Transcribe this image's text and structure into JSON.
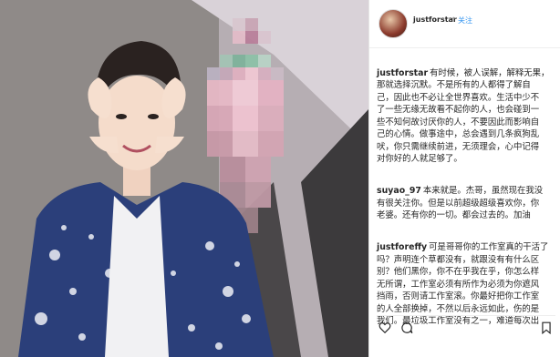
{
  "post": {
    "username": "justforstar",
    "separator": "•",
    "follow_label": "关注",
    "comments": [
      {
        "user": "justforstar",
        "text": "有时候，被人误解，解释无果，\n那就选择沉默。不是所有的人都得了解自\n己，因此也不必让全世界喜欢。生活中少不\n了一些无缘无故看不起你的人，也会碰到一\n些不知何故讨厌你的人，不要因此而影响自\n己的心情。做事途中，总会遇到几条疯狗乱\n吠，你只需继续前进，无须理会，心中记得\n对你好的人就足够了。"
      },
      {
        "user": "suyao_97",
        "text": "本来就是。杰哥，虽然现在我没\n有很关注你。但是以前超级超级喜欢你，你\n老婆。还有你的一切。都会过去的。加油"
      },
      {
        "user": "justforeffy",
        "text": "可是哥哥你的工作室真的干活了\n吗？声明连个草都没有，就跟没有有什么区\n别？他们黑你，你不在乎我在乎，你怎么样\n无所谓，工作室必须有所作为必须为你遮风\n挡雨，否则请工作室滚。你最好把你工作室\n的人全部换掉，不然以后永远如此，伤的是\n我们。最垃圾工作室没有之一，难道每次出"
      }
    ],
    "icons": {
      "like": "heart-icon",
      "comment": "comment-icon",
      "bookmark": "bookmark-icon"
    },
    "colors": {
      "link": "#3897f0",
      "text": "#262626"
    }
  }
}
